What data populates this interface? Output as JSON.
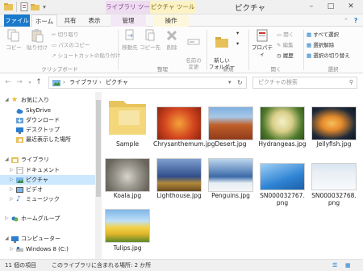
{
  "window": {
    "title": "ピクチャ",
    "context_tab_library": "ライブラリ ツール",
    "context_tab_picture": "ピクチャ ツール",
    "minimize": "–",
    "maximize": "□",
    "close": "✕"
  },
  "ribbon_tabs": {
    "file": "ファイル",
    "home": "ホーム",
    "share": "共有",
    "view": "表示",
    "manage_library": "管理",
    "manage_picture": "操作"
  },
  "ribbon": {
    "copy": "コピー",
    "paste": "貼り付け",
    "cut": "切り取り",
    "copy_path": "パスのコピー",
    "paste_shortcut": "ショートカットの貼り付け",
    "group_clipboard": "クリップボード",
    "move_to": "移動先",
    "copy_to": "コピー先",
    "delete": "削除",
    "rename": "名前の\n変更",
    "group_organize": "整理",
    "new_folder": "新しい\nフォルダー",
    "group_new": "新規",
    "properties": "プロパティ",
    "open": "開く",
    "edit": "編集",
    "history": "履歴",
    "group_open": "開く",
    "select_all": "すべて選択",
    "select_none": "選択解除",
    "invert_selection": "選択の切り替え",
    "group_select": "選択"
  },
  "address": {
    "breadcrumb_1": "ライブラリ",
    "breadcrumb_2": "ピクチャ",
    "separator": "›",
    "search_placeholder": "ピクチャの検索"
  },
  "nav": {
    "favorites": "お気に入り",
    "skydrive": "SkyDrive",
    "downloads": "ダウンロード",
    "desktop": "デスクトップ",
    "recent": "最近表示した場所",
    "libraries": "ライブラリ",
    "documents": "ドキュメント",
    "pictures": "ピクチャ",
    "videos": "ビデオ",
    "music": "ミュージック",
    "homegroup": "ホームグループ",
    "computer": "コンピューター",
    "drive_c": "Windows 8 (C:)"
  },
  "files": [
    {
      "name": "Sample",
      "kind": "folder"
    },
    {
      "name": "Chrysanthemum.jpg",
      "kind": "image",
      "color": "#d2451f"
    },
    {
      "name": "Desert.jpg",
      "kind": "image",
      "color": "#c0602a"
    },
    {
      "name": "Hydrangeas.jpg",
      "kind": "image",
      "color": "#d9cf8a"
    },
    {
      "name": "Jellyfish.jpg",
      "kind": "image",
      "color": "#e58a2c"
    },
    {
      "name": "Koala.jpg",
      "kind": "image",
      "color": "#9b9890"
    },
    {
      "name": "Lighthouse.jpg",
      "kind": "image",
      "color": "#2f4d8a"
    },
    {
      "name": "Penguins.jpg",
      "kind": "image",
      "color": "#3b6aa8"
    },
    {
      "name": "SN000032767.png",
      "kind": "image",
      "color": "#2f84d4"
    },
    {
      "name": "SN000032768.png",
      "kind": "image",
      "color": "#e8eef4"
    },
    {
      "name": "Tulips.jpg",
      "kind": "image",
      "color": "#e0b52a"
    }
  ],
  "status": {
    "item_count": "11 個の項目",
    "library_info": "このライブラリに含まれる場所: 2 か所"
  }
}
